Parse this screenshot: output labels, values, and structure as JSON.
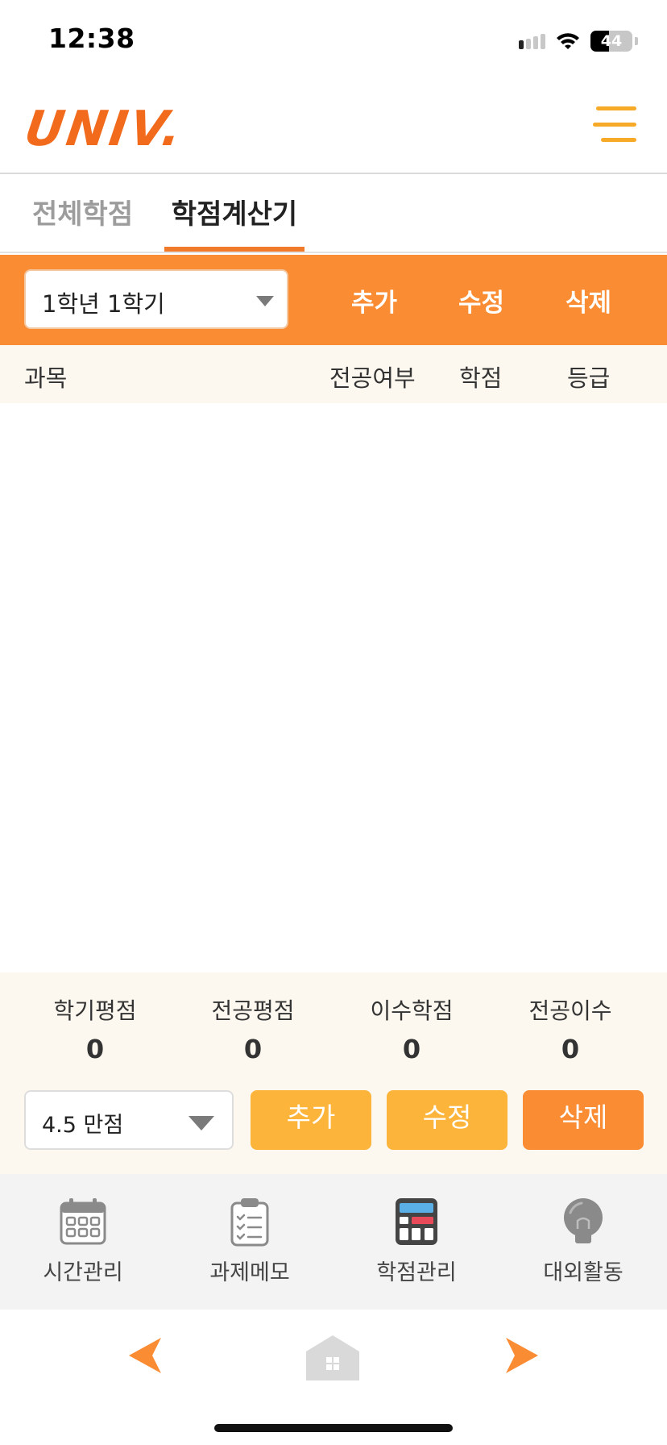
{
  "status_bar": {
    "time": "12:38",
    "battery": "44"
  },
  "header": {
    "logo_text": "UNIV."
  },
  "tabs": [
    {
      "label": "전체학점",
      "active": false
    },
    {
      "label": "학점계산기",
      "active": true
    }
  ],
  "toolbar": {
    "semester": "1학년 1학기",
    "add_label": "추가",
    "edit_label": "수정",
    "delete_label": "삭제"
  },
  "table": {
    "columns": [
      "과목",
      "전공여부",
      "학점",
      "등급"
    ],
    "rows": []
  },
  "summary": {
    "stats": [
      {
        "label": "학기평점",
        "value": "0"
      },
      {
        "label": "전공평점",
        "value": "0"
      },
      {
        "label": "이수학점",
        "value": "0"
      },
      {
        "label": "전공이수",
        "value": "0"
      }
    ],
    "scale": "4.5 만점",
    "add_label": "추가",
    "edit_label": "수정",
    "delete_label": "삭제"
  },
  "bottom_nav": [
    {
      "label": "시간관리",
      "icon": "calendar-icon"
    },
    {
      "label": "과제메모",
      "icon": "clipboard-icon"
    },
    {
      "label": "학점관리",
      "icon": "calculator-icon"
    },
    {
      "label": "대외활동",
      "icon": "lightbulb-icon"
    }
  ],
  "colors": {
    "accent": "#fa8c34",
    "button_yellow": "#fdb43a",
    "logo": "#f26b1d",
    "menu": "#f7a928",
    "panel": "#fdf8ef"
  }
}
